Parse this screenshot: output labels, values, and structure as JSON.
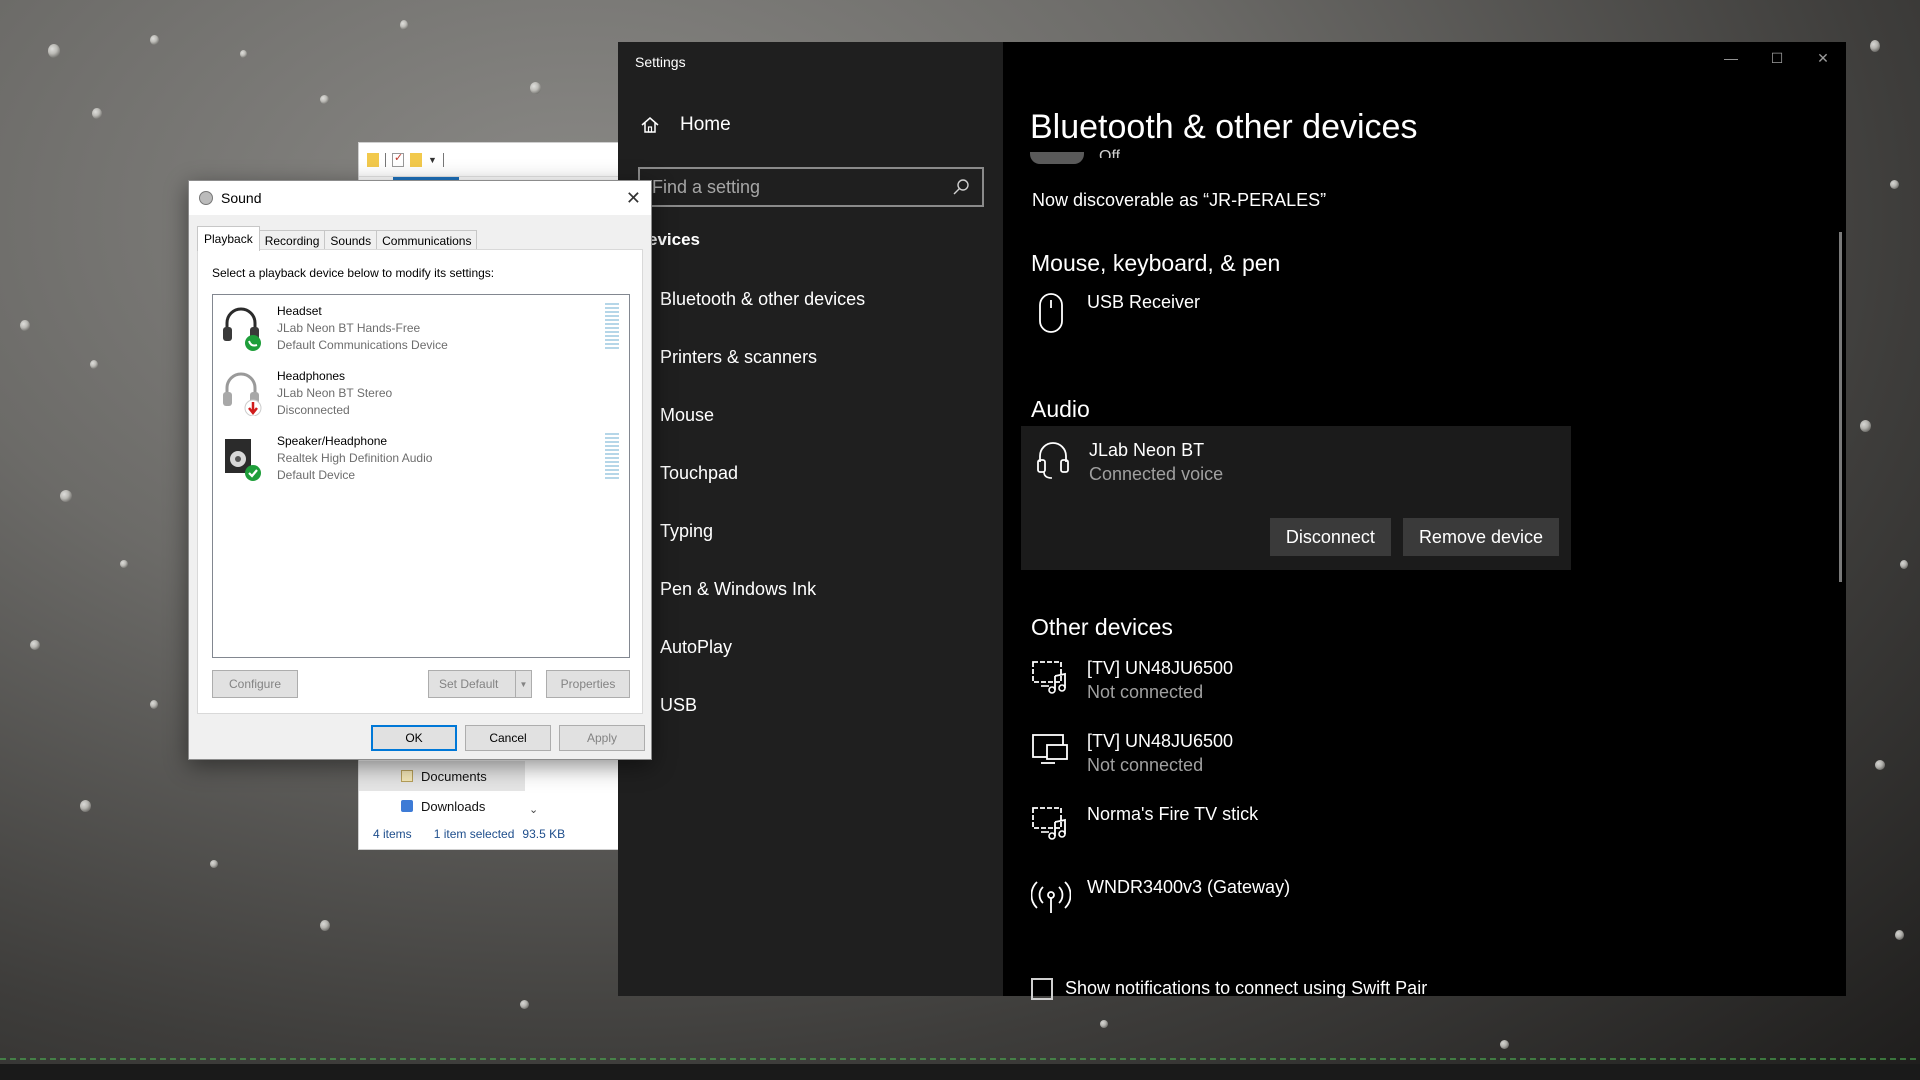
{
  "explorer": {
    "nav_items": [
      "Documents",
      "Downloads"
    ],
    "status_items": "4 items",
    "status_selected": "1 item selected",
    "status_size": "93.5 KB"
  },
  "settings": {
    "window_title": "Settings",
    "home_label": "Home",
    "search_placeholder": "Find a setting",
    "section_header": "evices",
    "nav_items": [
      {
        "label": "Bluetooth & other devices",
        "icon": "bluetooth-icon"
      },
      {
        "label": "Printers & scanners",
        "icon": "printer-icon"
      },
      {
        "label": "Mouse",
        "icon": "mouse-icon"
      },
      {
        "label": "Touchpad",
        "icon": "touchpad-icon"
      },
      {
        "label": "Typing",
        "icon": "keyboard-icon"
      },
      {
        "label": "Pen & Windows Ink",
        "icon": "pen-icon"
      },
      {
        "label": "AutoPlay",
        "icon": "autoplay-icon"
      },
      {
        "label": "USB",
        "icon": "usb-icon"
      }
    ],
    "page_title": "Bluetooth & other devices",
    "bluetooth_toggle_state": "Off",
    "discoverable_text": "Now discoverable as “JR-PERALES”",
    "mouse_section": "Mouse, keyboard, & pen",
    "mouse_devices": [
      {
        "name": "USB Receiver"
      }
    ],
    "audio_section": "Audio",
    "audio_device": {
      "name": "JLab Neon BT",
      "status": "Connected voice",
      "disconnect_label": "Disconnect",
      "remove_label": "Remove device"
    },
    "other_section": "Other devices",
    "other_devices": [
      {
        "name": "[TV] UN48JU6500",
        "status": "Not connected",
        "icon": "media-device-icon"
      },
      {
        "name": "[TV] UN48JU6500",
        "status": "Not connected",
        "icon": "display-device-icon"
      },
      {
        "name": "Norma's Fire TV stick",
        "status": "",
        "icon": "media-device-icon"
      },
      {
        "name": "WNDR3400v3 (Gateway)",
        "status": "",
        "icon": "wireless-icon"
      }
    ],
    "swift_pair_label": "Show notifications to connect using Swift Pair",
    "window_controls": {
      "minimize": "—",
      "maximize": "☐",
      "close": "✕"
    }
  },
  "sound_dialog": {
    "title": "Sound",
    "tabs": [
      "Playback",
      "Recording",
      "Sounds",
      "Communications"
    ],
    "active_tab": "Playback",
    "instruction": "Select a playback device below to modify its settings:",
    "devices": [
      {
        "name": "Headset",
        "driver": "JLab Neon BT Hands-Free",
        "state": "Default Communications Device",
        "badge": "phone-badge",
        "badge_color": "#1e9e3a"
      },
      {
        "name": "Headphones",
        "driver": "JLab Neon BT Stereo",
        "state": "Disconnected",
        "badge": "down-arrow-badge",
        "badge_color": "#d01c1c"
      },
      {
        "name": "Speaker/Headphone",
        "driver": "Realtek High Definition Audio",
        "state": "Default Device",
        "badge": "check-badge",
        "badge_color": "#1e9e3a"
      }
    ],
    "configure_label": "Configure",
    "set_default_label": "Set Default",
    "properties_label": "Properties",
    "ok_label": "OK",
    "cancel_label": "Cancel",
    "apply_label": "Apply"
  }
}
